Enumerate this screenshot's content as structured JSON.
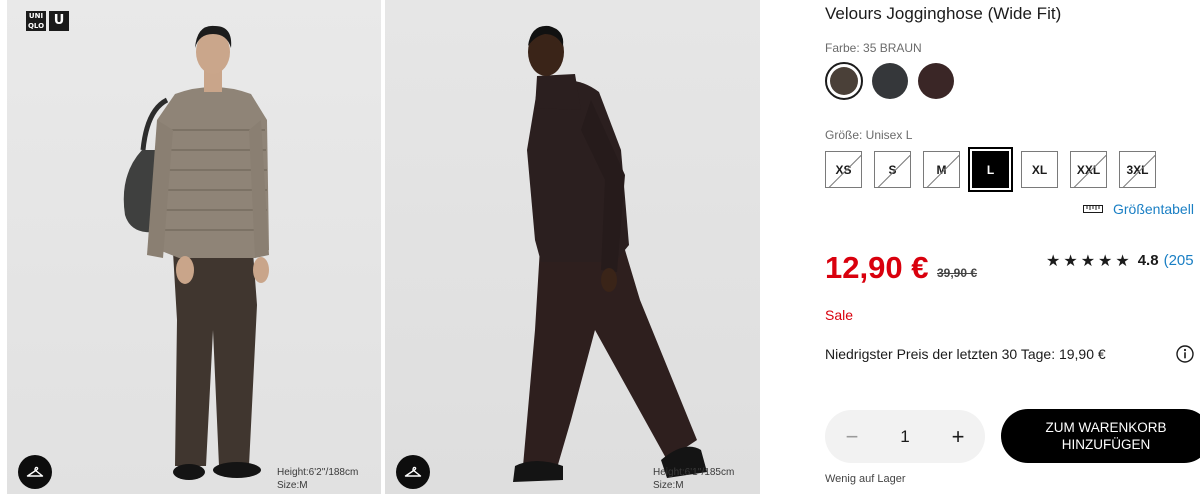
{
  "brand": {
    "logo_top_left": "UNI",
    "logo_bottom_left": "QLO",
    "logo_single": "U"
  },
  "images": [
    {
      "model_height": "Height:6'2''/188cm",
      "model_size": "Size:M",
      "action_icon": "hanger-icon"
    },
    {
      "model_height": "Height:6'1''/185cm",
      "model_size": "Size:M",
      "action_icon": "hanger-icon"
    }
  ],
  "product": {
    "title": "Velours Jogginghose (Wide Fit)",
    "color_label": "Farbe: 35 BRAUN",
    "colors": [
      {
        "name": "braun",
        "hex": "#4a4038",
        "selected": true
      },
      {
        "name": "dunkelgrau",
        "hex": "#35373a",
        "selected": false
      },
      {
        "name": "dunkelbraun",
        "hex": "#3a2626",
        "selected": false
      }
    ],
    "size_label": "Größe: Unisex L",
    "sizes": [
      {
        "label": "XS",
        "available": false
      },
      {
        "label": "S",
        "available": false
      },
      {
        "label": "M",
        "available": false
      },
      {
        "label": "L",
        "available": true,
        "selected": true
      },
      {
        "label": "XL",
        "available": true
      },
      {
        "label": "XXL",
        "available": false
      },
      {
        "label": "3XL",
        "available": false
      }
    ],
    "size_chart_link": "Größentabell",
    "price": "12,90 €",
    "old_price": "39,90 €",
    "rating": {
      "stars": "★★★★★",
      "value": "4.8",
      "count": "(205"
    },
    "sale_label": "Sale",
    "lowest_price": "Niedrigster Preis der letzten 30 Tage: 19,90 €",
    "quantity": "1",
    "qty_minus": "−",
    "qty_plus": "+",
    "add_to_cart": "ZUM WARENKORB\nHINZUFÜGEN",
    "stock_note": "Wenig auf Lager"
  },
  "colors": {
    "sale_red": "#d9000d",
    "link_blue": "#1a7fc4",
    "button_black": "#000000"
  }
}
